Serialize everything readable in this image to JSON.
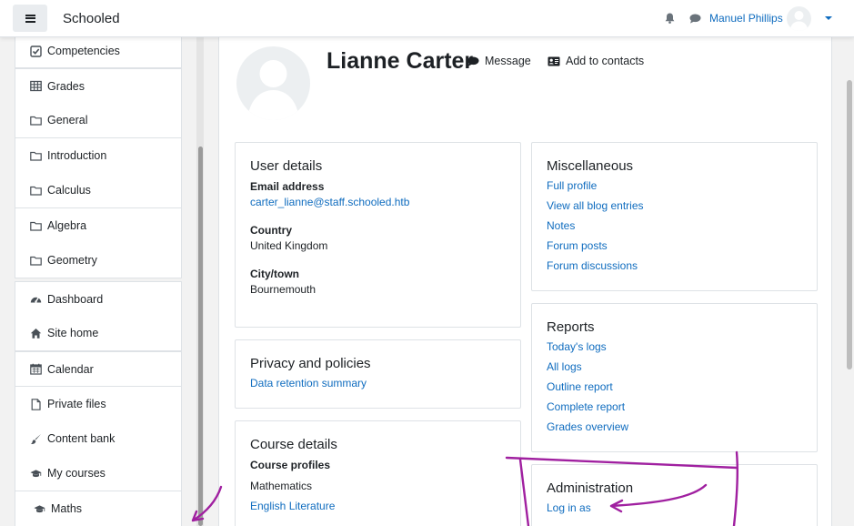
{
  "navbar": {
    "brand": "Schooled",
    "user_name": "Manuel Phillips"
  },
  "drawer": {
    "items": [
      {
        "label": "Competencies",
        "icon": "check-square-icon"
      },
      {
        "label": "Grades",
        "icon": "table-icon"
      },
      {
        "label": "General",
        "icon": "folder-icon"
      },
      {
        "label": "Introduction",
        "icon": "folder-icon"
      },
      {
        "label": "Calculus",
        "icon": "folder-icon"
      },
      {
        "label": "Algebra",
        "icon": "folder-icon"
      },
      {
        "label": "Geometry",
        "icon": "folder-icon"
      },
      {
        "label": "Dashboard",
        "icon": "dashboard-icon"
      },
      {
        "label": "Site home",
        "icon": "home-icon"
      },
      {
        "label": "Calendar",
        "icon": "calendar-icon"
      },
      {
        "label": "Private files",
        "icon": "file-icon"
      },
      {
        "label": "Content bank",
        "icon": "paint-brush-icon"
      },
      {
        "label": "My courses",
        "icon": "graduation-cap-icon"
      },
      {
        "label": "Maths",
        "icon": "graduation-cap-icon"
      }
    ]
  },
  "profile": {
    "name": "Lianne Carter",
    "message_label": "Message",
    "add_contact_label": "Add to contacts"
  },
  "user_details": {
    "title": "User details",
    "email_label": "Email address",
    "email": "carter_lianne@staff.schooled.htb",
    "country_label": "Country",
    "country": "United Kingdom",
    "city_label": "City/town",
    "city": "Bournemouth"
  },
  "privacy": {
    "title": "Privacy and policies",
    "link": "Data retention summary"
  },
  "course_details": {
    "title": "Course details",
    "profiles_label": "Course profiles",
    "courses": [
      "Mathematics",
      "English Literature"
    ]
  },
  "miscellaneous": {
    "title": "Miscellaneous",
    "links": [
      "Full profile",
      "View all blog entries",
      "Notes",
      "Forum posts",
      "Forum discussions"
    ]
  },
  "reports": {
    "title": "Reports",
    "links": [
      "Today's logs",
      "All logs",
      "Outline report",
      "Complete report",
      "Grades overview"
    ]
  },
  "administration": {
    "title": "Administration",
    "link": "Log in as"
  },
  "colors": {
    "link": "#0f6cbf",
    "annotation": "#a020a0"
  }
}
